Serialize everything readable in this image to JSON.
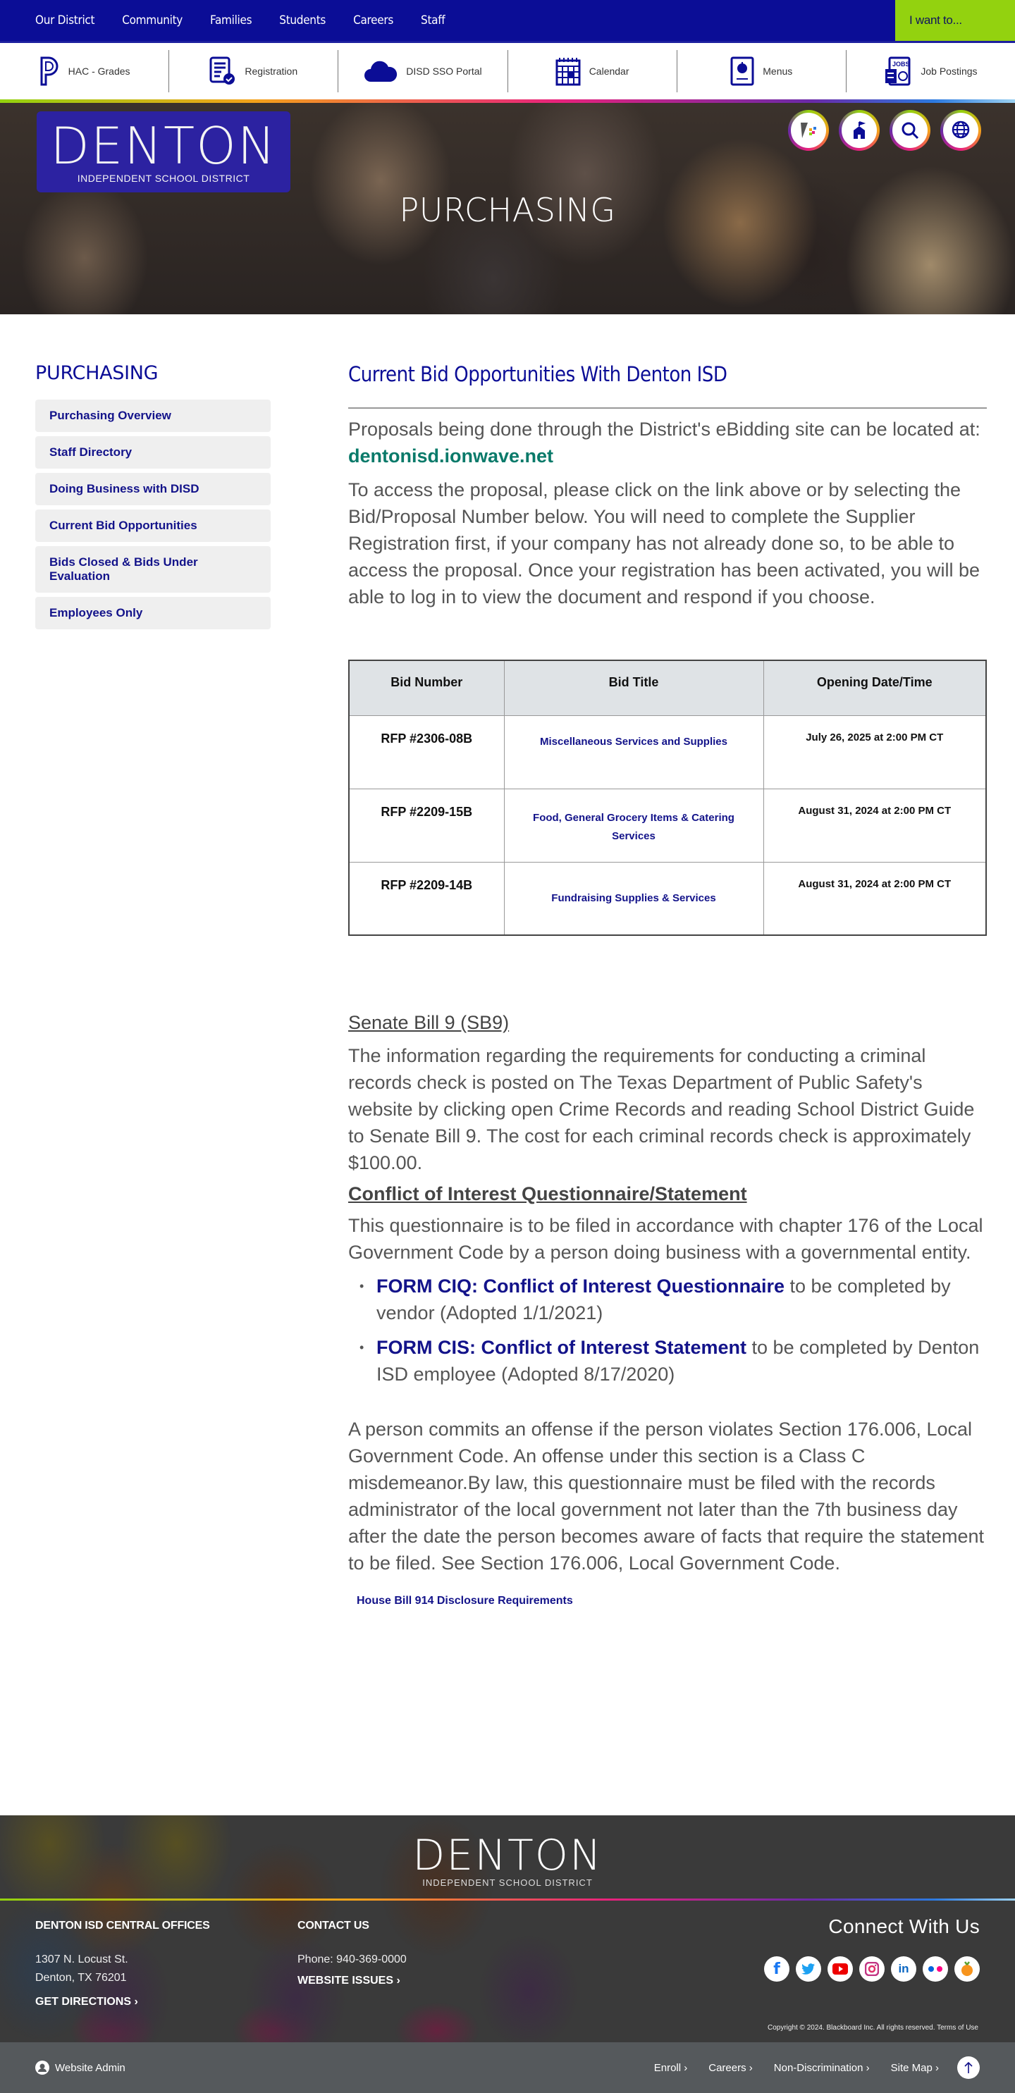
{
  "topnav": {
    "items": [
      "Our District",
      "Community",
      "Families",
      "Students",
      "Careers",
      "Staff"
    ],
    "want_label": "I want to..."
  },
  "quicklinks": [
    {
      "label": "HAC - Grades",
      "icon": "powerschool-icon"
    },
    {
      "label": "Registration",
      "icon": "registration-icon"
    },
    {
      "label": "DISD SSO Portal",
      "icon": "cloud-icon"
    },
    {
      "label": "Calendar",
      "icon": "calendar-icon"
    },
    {
      "label": "Menus",
      "icon": "menu-apple-icon"
    },
    {
      "label": "Job Postings",
      "icon": "jobs-icon"
    }
  ],
  "hero": {
    "logo_main": "DENTON",
    "logo_sub": "INDEPENDENT SCHOOL DISTRICT",
    "title": "PURCHASING",
    "icons": [
      "district-logo-icon",
      "schools-icon",
      "search-icon",
      "translate-globe-icon"
    ]
  },
  "sidebar": {
    "title": "PURCHASING",
    "items": [
      "Purchasing Overview",
      "Staff Directory",
      "Doing Business with DISD",
      "Current Bid Opportunities",
      "Bids Closed & Bids Under Evaluation",
      "Employees Only"
    ]
  },
  "main": {
    "heading": "Current Bid Opportunities With Denton ISD",
    "intro_prefix": "Proposals being done through the District's eBidding site can be located at: ",
    "intro_link": "dentonisd.ionwave.net",
    "access_text": "To access the proposal, please click on the link above or by selecting the Bid/Proposal Number below. You will need to complete the Supplier Registration first, if your company has not already done so, to be able to access the proposal.  Once your registration has been activated, you will be able to log in to view the document and respond if you choose.",
    "table": {
      "headers": [
        "Bid Number",
        "Bid Title",
        "Opening Date/Time"
      ],
      "rows": [
        {
          "number": "RFP #2306-08B",
          "title": "Miscellaneous Services and Supplies",
          "date": "July 26, 2025 at 2:00 PM CT"
        },
        {
          "number": "RFP #2209-15B",
          "title": "Food, General Grocery Items & Catering Services",
          "date": "August 31, 2024 at 2:00 PM CT"
        },
        {
          "number": "RFP #2209-14B",
          "title": "Fundraising Supplies & Services",
          "date": "August 31, 2024 at 2:00 PM CT"
        }
      ]
    },
    "sb9_heading": "Senate Bill 9 (SB9)",
    "sb9_text": "The information regarding the requirements for conducting a criminal records check is posted on The Texas Department of Public Safety's website by clicking open Crime Records and reading School District Guide to Senate Bill 9.  The cost for each criminal records check is approximately $100.00.",
    "coi_heading": "Conflict of Interest Questionnaire/Statement",
    "coi_text": "This questionnaire is to be filed in accordance with chapter 176 of the Local Government Code by a person doing business with a governmental entity.",
    "forms": [
      {
        "link": "FORM CIQ: Conflict of Interest Questionnaire",
        "suffix": " to be completed by vendor (Adopted 1/1/2021)"
      },
      {
        "link": "FORM CIS: Conflict of Interest Statement",
        "suffix": " to be completed by Denton ISD employee (Adopted 8/17/2020)"
      }
    ],
    "offense_text": "A person commits an offense if the person violates Section 176.006, Local Government Code. An offense under this section is a Class C misdemeanor.By law, this questionnaire must be filed with the records administrator of the local government not later than the 7th business day after the date the person becomes aware of facts that require the statement to be filed. See Section 176.006, Local Government Code.",
    "hb914_link": "House Bill 914 Disclosure Requirements"
  },
  "footer": {
    "logo_main": "DENTON",
    "logo_sub": "INDEPENDENT SCHOOL DISTRICT",
    "offices_heading": "DENTON ISD CENTRAL OFFICES",
    "address_line1": "1307 N. Locust St.",
    "address_line2": "Denton, TX 76201",
    "directions": "GET DIRECTIONS ›",
    "contact_heading": "CONTACT US",
    "phone": "Phone: 940-369-0000",
    "website_issues": "WEBSITE ISSUES ›",
    "connect_heading": "Connect With Us",
    "socials": [
      "facebook",
      "twitter",
      "youtube",
      "instagram",
      "linkedin",
      "flickr",
      "peachjar"
    ],
    "copyright": "Copyright © 2024. Blackboard Inc. All rights reserved.",
    "terms": "Terms of Use"
  },
  "bottombar": {
    "admin": "Website Admin",
    "links": [
      "Enroll ›",
      "Careers ›",
      "Non-Discrimination ›",
      "Site Map ›"
    ]
  },
  "colors": {
    "primary": "#0b0d96",
    "accent_green": "#93d20f",
    "link_teal": "#0a7a6a"
  }
}
